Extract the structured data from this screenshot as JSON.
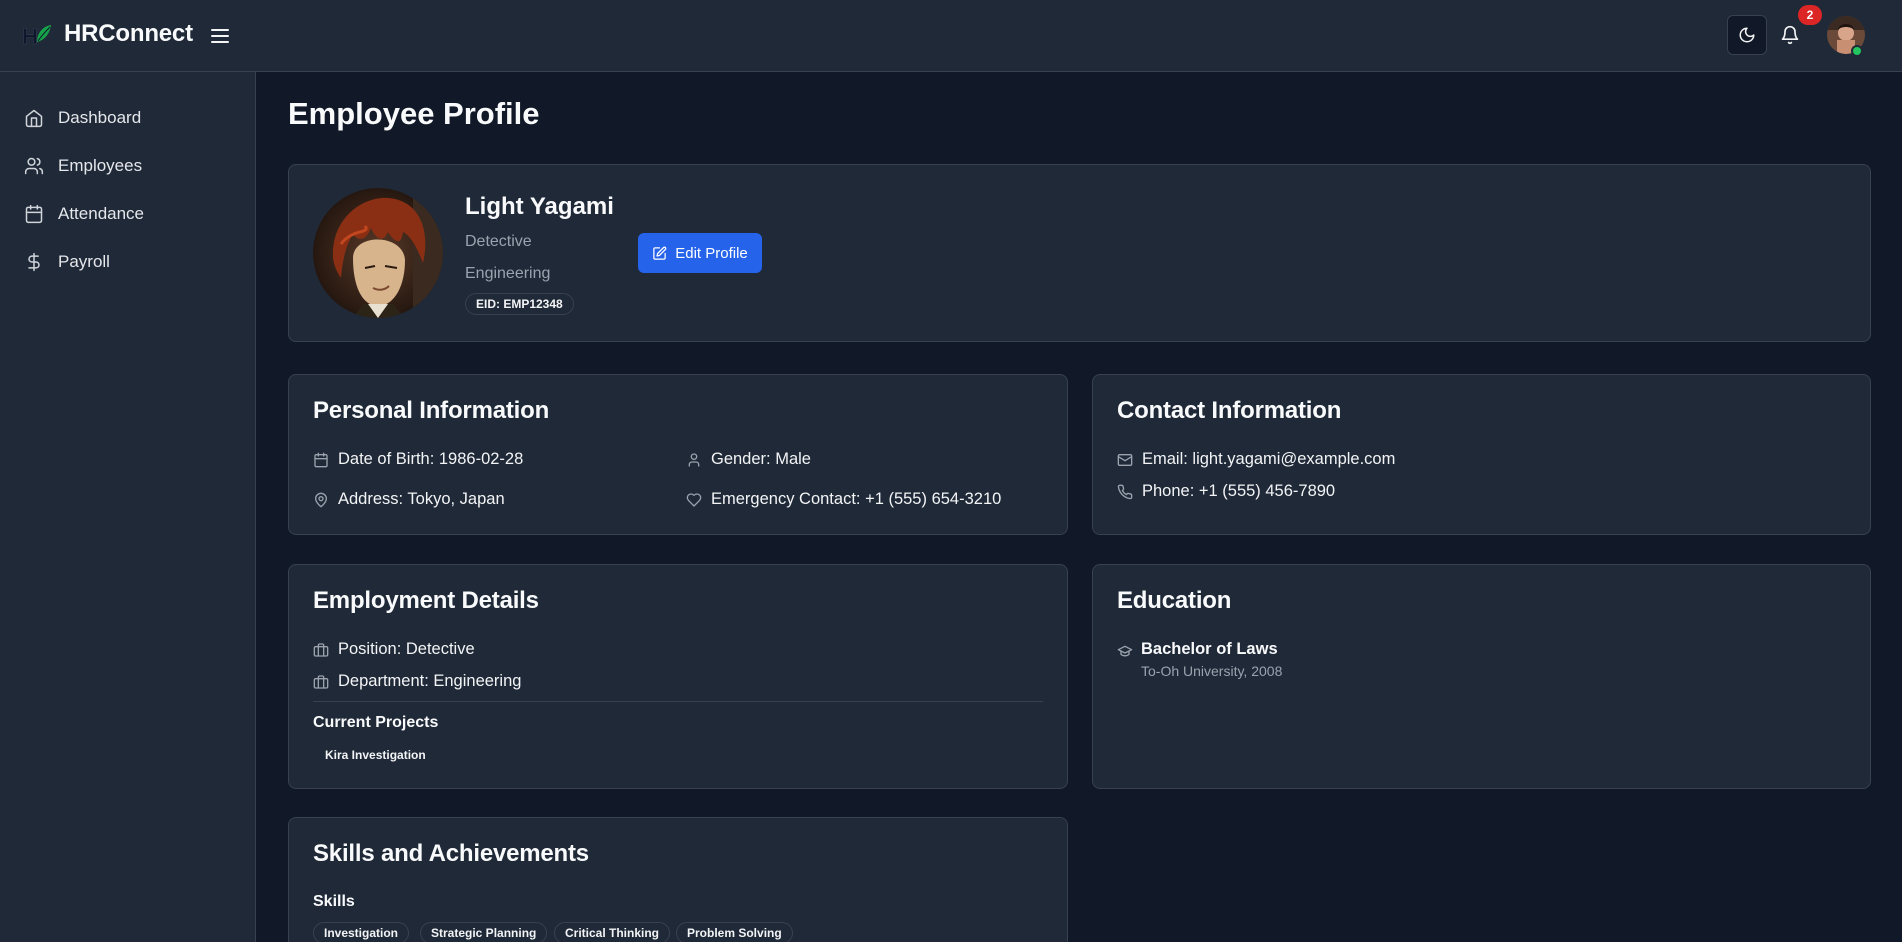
{
  "header": {
    "app_title": "HRConnect",
    "logo_text": "HC",
    "notification_count": "2",
    "icons": {
      "menu": "hamburger-icon",
      "theme": "moon-icon",
      "notifications": "bell-icon"
    }
  },
  "sidebar": {
    "items": [
      {
        "label": "Dashboard",
        "icon": "home-icon"
      },
      {
        "label": "Employees",
        "icon": "users-icon"
      },
      {
        "label": "Attendance",
        "icon": "calendar-icon"
      },
      {
        "label": "Payroll",
        "icon": "dollar-icon"
      }
    ]
  },
  "page": {
    "title": "Employee Profile"
  },
  "profile": {
    "name": "Light Yagami",
    "position": "Detective",
    "department": "Engineering",
    "eid": "EID: EMP12348",
    "edit_label": "Edit Profile"
  },
  "personal": {
    "title": "Personal Information",
    "dob": "Date of Birth: 1986-02-28",
    "gender": "Gender: Male",
    "address": "Address: Tokyo, Japan",
    "emergency": "Emergency Contact: +1 (555) 654-3210"
  },
  "contact": {
    "title": "Contact Information",
    "email": "Email: light.yagami@example.com",
    "phone": "Phone: +1 (555) 456-7890"
  },
  "employment": {
    "title": "Employment Details",
    "position": "Position: Detective",
    "department": "Department: Engineering",
    "projects_title": "Current Projects",
    "projects": [
      "Kira Investigation"
    ]
  },
  "education": {
    "title": "Education",
    "degree": "Bachelor of Laws",
    "school": "To-Oh University, 2008"
  },
  "skills": {
    "title": "Skills and Achievements",
    "skills_title": "Skills",
    "skills": [
      "Investigation",
      "Strategic Planning",
      "Critical Thinking",
      "Problem Solving"
    ]
  },
  "colors": {
    "accent": "#2563eb",
    "badge": "#dc2626",
    "online": "#22c55e",
    "background": "#111827",
    "card": "#1f2937"
  }
}
